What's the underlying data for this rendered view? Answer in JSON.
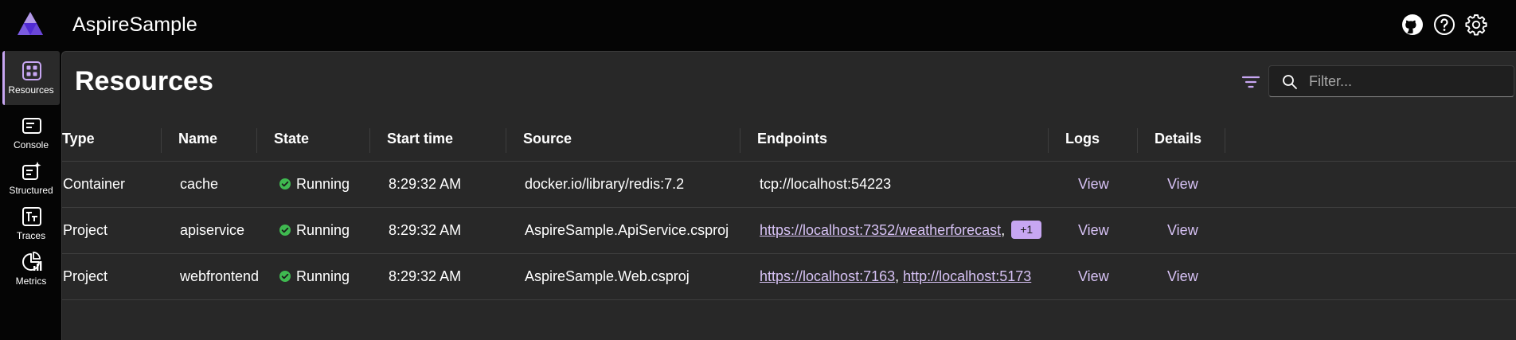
{
  "app": {
    "title": "AspireSample"
  },
  "header_icons": [
    "github-icon",
    "help-icon",
    "settings-icon"
  ],
  "nav": [
    {
      "label": "Resources",
      "icon": "resources-icon",
      "active": true
    },
    {
      "label": "Console",
      "icon": "console-icon"
    },
    {
      "label": "Structured",
      "icon": "structured-logs-icon"
    },
    {
      "label": "Traces",
      "icon": "traces-icon"
    },
    {
      "label": "Metrics",
      "icon": "metrics-icon"
    }
  ],
  "page": {
    "title": "Resources"
  },
  "filter": {
    "placeholder": "Filter..."
  },
  "table": {
    "columns": [
      "Type",
      "Name",
      "State",
      "Start time",
      "Source",
      "Endpoints",
      "Logs",
      "Details"
    ],
    "rows": [
      {
        "type": "Container",
        "name": "cache",
        "state": "Running",
        "start_time": "8:29:32 AM",
        "source": "docker.io/library/redis:7.2",
        "endpoint_text": "tcp://localhost:54223",
        "logs": "View",
        "details": "View"
      },
      {
        "type": "Project",
        "name": "apiservice",
        "state": "Running",
        "start_time": "8:29:32 AM",
        "source": "AspireSample.ApiService.csproj",
        "endpoint_link1": "https://localhost:7352/weatherforecast",
        "endpoint_more": "+1",
        "logs": "View",
        "details": "View"
      },
      {
        "type": "Project",
        "name": "webfrontend",
        "state": "Running",
        "start_time": "8:29:32 AM",
        "source": "AspireSample.Web.csproj",
        "endpoint_link1": "https://localhost:7163",
        "endpoint_link2": "http://localhost:5173",
        "logs": "View",
        "details": "View"
      }
    ]
  },
  "colors": {
    "accent": "#c7a6f2",
    "link": "#d7c2f5",
    "running": "#3fb950",
    "panel": "#282828",
    "chrome": "#050505"
  }
}
